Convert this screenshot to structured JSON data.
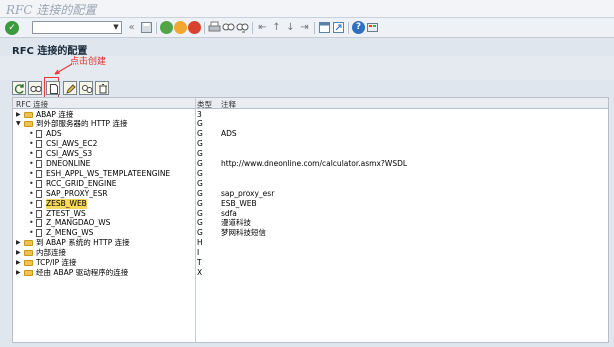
{
  "window": {
    "title": "RFC 连接的配置"
  },
  "header": {
    "title": "RFC 连接的配置"
  },
  "annotation": {
    "text": "点击创建"
  },
  "tree": {
    "columns": [
      "RFC 连接",
      "类型",
      "注释"
    ],
    "rows": [
      {
        "level": 0,
        "kind": "folder",
        "expand": "right",
        "name": "ABAP 连接",
        "type": "3",
        "comment": ""
      },
      {
        "level": 0,
        "kind": "folder",
        "expand": "down",
        "name": "到外部服务器的 HTTP 连接",
        "type": "G",
        "comment": ""
      },
      {
        "level": 1,
        "kind": "doc",
        "name": "ADS",
        "type": "G",
        "comment": "ADS"
      },
      {
        "level": 1,
        "kind": "doc",
        "name": "CSI_AWS_EC2",
        "type": "G",
        "comment": ""
      },
      {
        "level": 1,
        "kind": "doc",
        "name": "CSI_AWS_S3",
        "type": "G",
        "comment": ""
      },
      {
        "level": 1,
        "kind": "doc",
        "name": "DNEONLINE",
        "type": "G",
        "comment": "http://www.dneonline.com/calculator.asmx?WSDL"
      },
      {
        "level": 1,
        "kind": "doc",
        "name": "ESH_APPL_WS_TEMPLATEENGINE",
        "type": "G",
        "comment": ""
      },
      {
        "level": 1,
        "kind": "doc",
        "name": "RCC_GRID_ENGINE",
        "type": "G",
        "comment": ""
      },
      {
        "level": 1,
        "kind": "doc",
        "name": "SAP_PROXY_ESR",
        "type": "G",
        "comment": "sap_proxy_esr"
      },
      {
        "level": 1,
        "kind": "doc",
        "name": "ZESB_WEB",
        "type": "G",
        "comment": "ESB_WEB",
        "highlight": true
      },
      {
        "level": 1,
        "kind": "doc",
        "name": "ZTEST_WS",
        "type": "G",
        "comment": "sdfa"
      },
      {
        "level": 1,
        "kind": "doc",
        "name": "Z_MANGDAO_WS",
        "type": "G",
        "comment": "漫道科技"
      },
      {
        "level": 1,
        "kind": "doc",
        "name": "Z_MENG_WS",
        "type": "G",
        "comment": "梦网科技短信"
      },
      {
        "level": 0,
        "kind": "folder",
        "expand": "right",
        "name": "到 ABAP 系统的 HTTP 连接",
        "type": "H",
        "comment": ""
      },
      {
        "level": 0,
        "kind": "folder",
        "expand": "right",
        "name": "内部连接",
        "type": "I",
        "comment": ""
      },
      {
        "level": 0,
        "kind": "folder",
        "expand": "right",
        "name": "TCP/IP 连接",
        "type": "T",
        "comment": ""
      },
      {
        "level": 0,
        "kind": "folder",
        "expand": "right",
        "name": "经由 ABAP 驱动程序的连接",
        "type": "X",
        "comment": ""
      }
    ]
  },
  "icons": {
    "standard_toolbar": [
      "ok-icon",
      "back-icon",
      "save-icon",
      "green-back-icon",
      "exit-icon",
      "cancel-icon",
      "print-icon",
      "find-icon",
      "find-next-icon",
      "first-page-icon",
      "prev-page-icon",
      "next-page-icon",
      "last-page-icon",
      "new-session-icon",
      "shortcut-icon",
      "help-icon",
      "customize-icon"
    ],
    "app_toolbar": [
      "refresh-icon",
      "find-icon",
      "create-icon",
      "change-icon",
      "copy-icon",
      "delete-icon"
    ]
  },
  "colors": {
    "annotation": "#e53a3a",
    "selection": "#f7d85a",
    "folder": "#f2c14e"
  }
}
